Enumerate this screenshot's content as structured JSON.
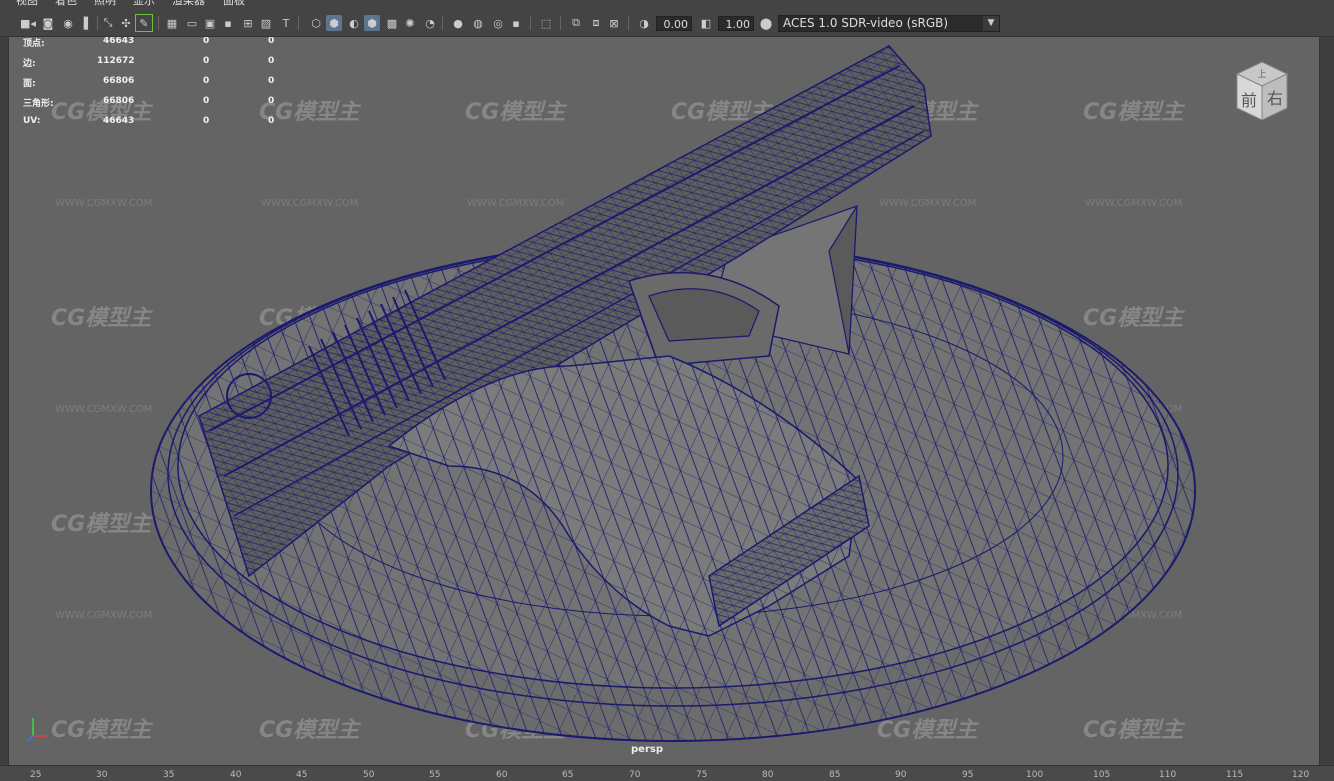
{
  "menu": [
    "视图",
    "着色",
    "照明",
    "显示",
    "渲染器",
    "面板"
  ],
  "toolbar": {
    "exposure_value": "0.00",
    "gamma_value": "1.00",
    "color_space": "ACES 1.0 SDR-video (sRGB)",
    "icons": [
      "select-camera-icon",
      "camera-attributes-icon",
      "bookmark-icon",
      "image-plane-icon",
      "2d-pan-zoom-icon",
      "grease-pencil-icon",
      "grid-icon",
      "film-gate-icon",
      "resolution-gate-icon",
      "gate-mask-icon",
      "field-chart-icon",
      "safe-action-icon",
      "safe-title-icon",
      "wireframe-icon",
      "smooth-shade-icon",
      "shade-toggle-icon",
      "wireframe-on-shaded-icon",
      "xray-icon",
      "default-lighting-icon",
      "shadows-icon",
      "ambient-occlusion-icon",
      "motion-blur-icon",
      "anti-alias-icon",
      "isolate-select-icon",
      "xray-joints-icon",
      "xray-active-icon",
      "exposure-icon",
      "gamma-icon",
      "color-management-icon"
    ]
  },
  "stats": {
    "rows": [
      {
        "label": "顶点:",
        "v1": "46643",
        "v2": "0",
        "v3": "0"
      },
      {
        "label": "边:",
        "v1": "112672",
        "v2": "0",
        "v3": "0"
      },
      {
        "label": "面:",
        "v1": "66806",
        "v2": "0",
        "v3": "0"
      },
      {
        "label": "三角形:",
        "v1": "66806",
        "v2": "0",
        "v3": "0"
      },
      {
        "label": "UV:",
        "v1": "46643",
        "v2": "0",
        "v3": "0"
      }
    ]
  },
  "viewcube": {
    "top": "上",
    "front": "前",
    "right": "右"
  },
  "camera_label": "persp",
  "watermark": {
    "logo": "CG模型主",
    "url": "WWW.CGMXW.COM"
  },
  "ruler_ticks": [
    "25",
    "30",
    "35",
    "40",
    "45",
    "50",
    "55",
    "60",
    "65",
    "70",
    "75",
    "80",
    "85",
    "90",
    "95",
    "100",
    "105",
    "110",
    "115",
    "120"
  ],
  "colors": {
    "wire": "#1a1a6e",
    "viewport_bg": "#646464",
    "accent": "#5d7690"
  }
}
